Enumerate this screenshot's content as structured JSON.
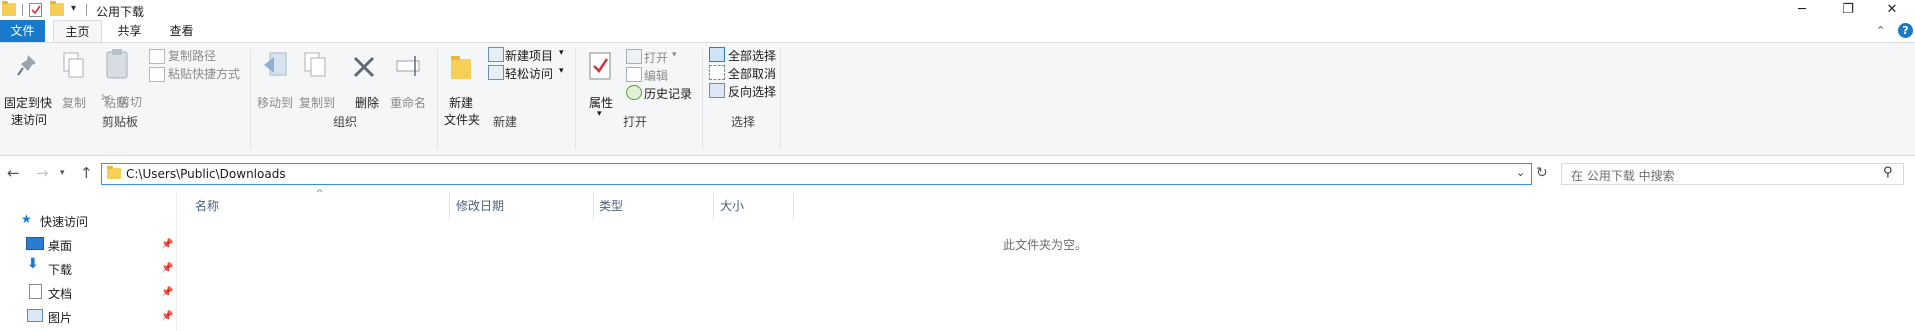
{
  "window": {
    "title": "公用下载",
    "minimize_glyph": "─",
    "restore_glyph": "❐",
    "close_glyph": "✕"
  },
  "tabs": {
    "file": "文件",
    "home": "主页",
    "share": "共享",
    "view": "查看"
  },
  "ribbon": {
    "clipboard": {
      "pin_line1": "固定到快",
      "pin_line2": "速访问",
      "copy": "复制",
      "paste": "粘贴",
      "copy_path": "复制路径",
      "paste_shortcut": "粘贴快捷方式",
      "cut": "剪切",
      "label": "剪贴板"
    },
    "organize": {
      "move_to": "移动到",
      "copy_to": "复制到",
      "delete": "删除",
      "rename": "重命名",
      "label": "组织"
    },
    "new": {
      "new_folder_line1": "新建",
      "new_folder_line2": "文件夹",
      "new_item": "新建项目",
      "easy_access": "轻松访问",
      "label": "新建"
    },
    "open": {
      "properties": "属性",
      "open": "打开",
      "edit": "编辑",
      "history": "历史记录",
      "label": "打开"
    },
    "select": {
      "select_all": "全部选择",
      "select_none": "全部取消",
      "invert": "反向选择",
      "label": "选择"
    }
  },
  "address": {
    "path": "C:\\Users\\Public\\Downloads",
    "search_placeholder": "在 公用下载 中搜索"
  },
  "nav_pane": {
    "quick_access": "快速访问",
    "items": [
      "桌面",
      "下载",
      "文档",
      "图片"
    ]
  },
  "columns": [
    "名称",
    "修改日期",
    "类型",
    "大小"
  ],
  "empty_message": "此文件夹为空。",
  "icons": {
    "back": "back-arrow-icon",
    "forward": "forward-arrow-icon",
    "up": "up-arrow-icon",
    "refresh": "refresh-icon",
    "search": "search-icon",
    "help": "help-icon"
  },
  "colors": {
    "accent": "#1979ca",
    "folder": "#f6cf57",
    "ribbon_bg": "#f5f6f7",
    "address_border": "#3c8ee0"
  }
}
